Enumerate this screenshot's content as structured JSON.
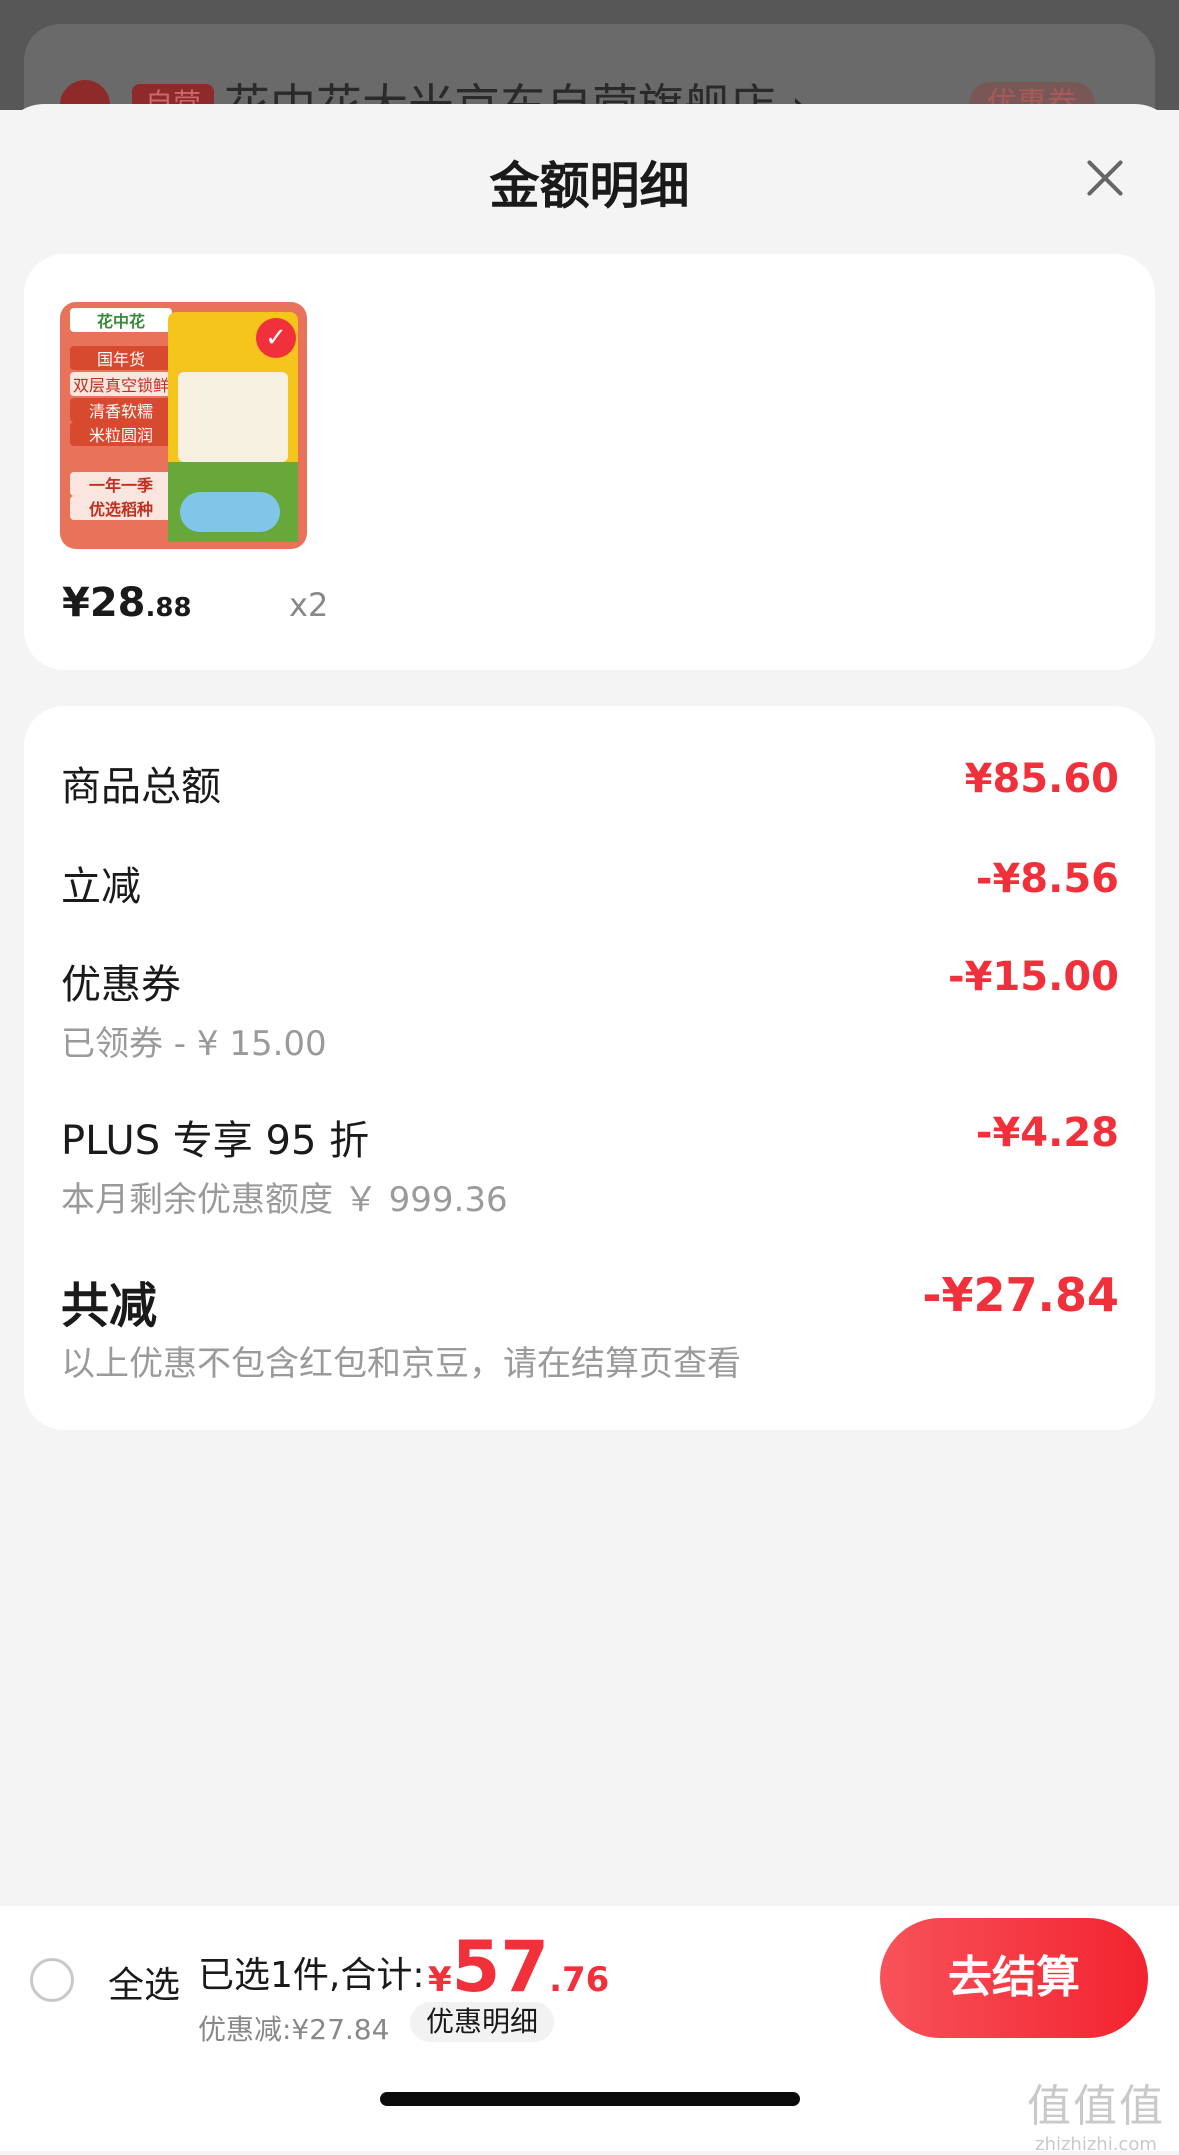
{
  "background_page": {
    "store_badge": "自营",
    "store_name": "花中花大米京东自营旗舰店 ›",
    "coupon": "优惠券"
  },
  "sheet": {
    "title": "金额明细"
  },
  "product": {
    "image_labels": [
      "国年货",
      "双层真空锁鲜",
      "清香软糯",
      "米粒圆润",
      "一年一季",
      "优选稻种"
    ],
    "image_brand": "花中花",
    "price_currency": "¥",
    "price_int": "28",
    "price_dec": ".88",
    "quantity": "x2"
  },
  "details": {
    "goods_total_label": "商品总额",
    "goods_total_value": "¥85.60",
    "instant_label": "立减",
    "instant_value": "-¥8.56",
    "coupon_label": "优惠券",
    "coupon_sub": "已领券 - ¥ 15.00",
    "coupon_value": "-¥15.00",
    "plus_label": "PLUS 专享 95 折",
    "plus_sub": "本月剩余优惠额度 ￥ 999.36",
    "plus_value": "-¥4.28",
    "total_label": "共减",
    "total_value": "-¥27.84",
    "note": "以上优惠不包含红包和京豆，请在结算页查看"
  },
  "bottom_bar": {
    "select_all": "全选",
    "selected_text": "已选1件,合计:",
    "total_sym": "¥",
    "total_int": "57",
    "total_dec": ".76",
    "discount_text": "优惠减:¥27.84",
    "detail_link": "优惠明细",
    "checkout": "去结算"
  },
  "watermark": {
    "main": "值值值",
    "url": "zhizhizhi.com"
  }
}
